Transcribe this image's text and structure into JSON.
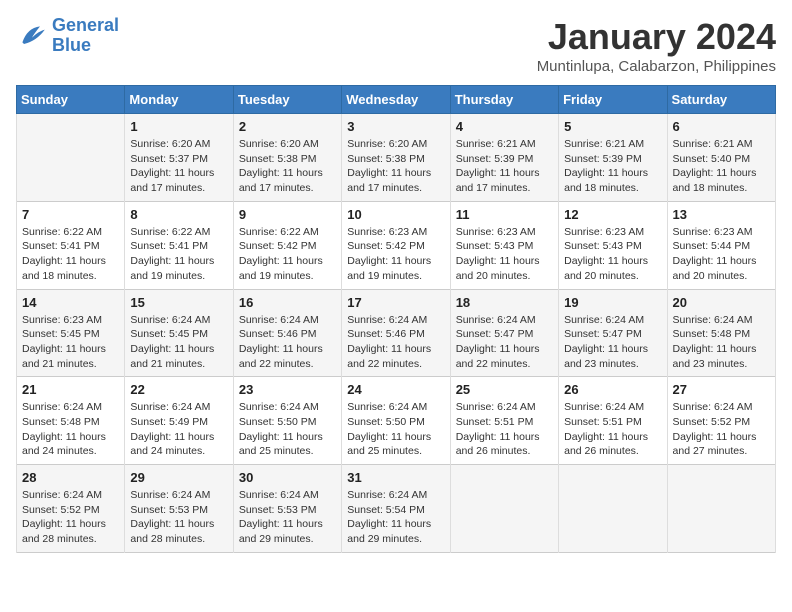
{
  "logo": {
    "line1": "General",
    "line2": "Blue"
  },
  "title": "January 2024",
  "subtitle": "Muntinlupa, Calabarzon, Philippines",
  "headers": [
    "Sunday",
    "Monday",
    "Tuesday",
    "Wednesday",
    "Thursday",
    "Friday",
    "Saturday"
  ],
  "weeks": [
    [
      {
        "num": "",
        "sunrise": "",
        "sunset": "",
        "daylight": ""
      },
      {
        "num": "1",
        "sunrise": "Sunrise: 6:20 AM",
        "sunset": "Sunset: 5:37 PM",
        "daylight": "Daylight: 11 hours and 17 minutes."
      },
      {
        "num": "2",
        "sunrise": "Sunrise: 6:20 AM",
        "sunset": "Sunset: 5:38 PM",
        "daylight": "Daylight: 11 hours and 17 minutes."
      },
      {
        "num": "3",
        "sunrise": "Sunrise: 6:20 AM",
        "sunset": "Sunset: 5:38 PM",
        "daylight": "Daylight: 11 hours and 17 minutes."
      },
      {
        "num": "4",
        "sunrise": "Sunrise: 6:21 AM",
        "sunset": "Sunset: 5:39 PM",
        "daylight": "Daylight: 11 hours and 17 minutes."
      },
      {
        "num": "5",
        "sunrise": "Sunrise: 6:21 AM",
        "sunset": "Sunset: 5:39 PM",
        "daylight": "Daylight: 11 hours and 18 minutes."
      },
      {
        "num": "6",
        "sunrise": "Sunrise: 6:21 AM",
        "sunset": "Sunset: 5:40 PM",
        "daylight": "Daylight: 11 hours and 18 minutes."
      }
    ],
    [
      {
        "num": "7",
        "sunrise": "Sunrise: 6:22 AM",
        "sunset": "Sunset: 5:41 PM",
        "daylight": "Daylight: 11 hours and 18 minutes."
      },
      {
        "num": "8",
        "sunrise": "Sunrise: 6:22 AM",
        "sunset": "Sunset: 5:41 PM",
        "daylight": "Daylight: 11 hours and 19 minutes."
      },
      {
        "num": "9",
        "sunrise": "Sunrise: 6:22 AM",
        "sunset": "Sunset: 5:42 PM",
        "daylight": "Daylight: 11 hours and 19 minutes."
      },
      {
        "num": "10",
        "sunrise": "Sunrise: 6:23 AM",
        "sunset": "Sunset: 5:42 PM",
        "daylight": "Daylight: 11 hours and 19 minutes."
      },
      {
        "num": "11",
        "sunrise": "Sunrise: 6:23 AM",
        "sunset": "Sunset: 5:43 PM",
        "daylight": "Daylight: 11 hours and 20 minutes."
      },
      {
        "num": "12",
        "sunrise": "Sunrise: 6:23 AM",
        "sunset": "Sunset: 5:43 PM",
        "daylight": "Daylight: 11 hours and 20 minutes."
      },
      {
        "num": "13",
        "sunrise": "Sunrise: 6:23 AM",
        "sunset": "Sunset: 5:44 PM",
        "daylight": "Daylight: 11 hours and 20 minutes."
      }
    ],
    [
      {
        "num": "14",
        "sunrise": "Sunrise: 6:23 AM",
        "sunset": "Sunset: 5:45 PM",
        "daylight": "Daylight: 11 hours and 21 minutes."
      },
      {
        "num": "15",
        "sunrise": "Sunrise: 6:24 AM",
        "sunset": "Sunset: 5:45 PM",
        "daylight": "Daylight: 11 hours and 21 minutes."
      },
      {
        "num": "16",
        "sunrise": "Sunrise: 6:24 AM",
        "sunset": "Sunset: 5:46 PM",
        "daylight": "Daylight: 11 hours and 22 minutes."
      },
      {
        "num": "17",
        "sunrise": "Sunrise: 6:24 AM",
        "sunset": "Sunset: 5:46 PM",
        "daylight": "Daylight: 11 hours and 22 minutes."
      },
      {
        "num": "18",
        "sunrise": "Sunrise: 6:24 AM",
        "sunset": "Sunset: 5:47 PM",
        "daylight": "Daylight: 11 hours and 22 minutes."
      },
      {
        "num": "19",
        "sunrise": "Sunrise: 6:24 AM",
        "sunset": "Sunset: 5:47 PM",
        "daylight": "Daylight: 11 hours and 23 minutes."
      },
      {
        "num": "20",
        "sunrise": "Sunrise: 6:24 AM",
        "sunset": "Sunset: 5:48 PM",
        "daylight": "Daylight: 11 hours and 23 minutes."
      }
    ],
    [
      {
        "num": "21",
        "sunrise": "Sunrise: 6:24 AM",
        "sunset": "Sunset: 5:48 PM",
        "daylight": "Daylight: 11 hours and 24 minutes."
      },
      {
        "num": "22",
        "sunrise": "Sunrise: 6:24 AM",
        "sunset": "Sunset: 5:49 PM",
        "daylight": "Daylight: 11 hours and 24 minutes."
      },
      {
        "num": "23",
        "sunrise": "Sunrise: 6:24 AM",
        "sunset": "Sunset: 5:50 PM",
        "daylight": "Daylight: 11 hours and 25 minutes."
      },
      {
        "num": "24",
        "sunrise": "Sunrise: 6:24 AM",
        "sunset": "Sunset: 5:50 PM",
        "daylight": "Daylight: 11 hours and 25 minutes."
      },
      {
        "num": "25",
        "sunrise": "Sunrise: 6:24 AM",
        "sunset": "Sunset: 5:51 PM",
        "daylight": "Daylight: 11 hours and 26 minutes."
      },
      {
        "num": "26",
        "sunrise": "Sunrise: 6:24 AM",
        "sunset": "Sunset: 5:51 PM",
        "daylight": "Daylight: 11 hours and 26 minutes."
      },
      {
        "num": "27",
        "sunrise": "Sunrise: 6:24 AM",
        "sunset": "Sunset: 5:52 PM",
        "daylight": "Daylight: 11 hours and 27 minutes."
      }
    ],
    [
      {
        "num": "28",
        "sunrise": "Sunrise: 6:24 AM",
        "sunset": "Sunset: 5:52 PM",
        "daylight": "Daylight: 11 hours and 28 minutes."
      },
      {
        "num": "29",
        "sunrise": "Sunrise: 6:24 AM",
        "sunset": "Sunset: 5:53 PM",
        "daylight": "Daylight: 11 hours and 28 minutes."
      },
      {
        "num": "30",
        "sunrise": "Sunrise: 6:24 AM",
        "sunset": "Sunset: 5:53 PM",
        "daylight": "Daylight: 11 hours and 29 minutes."
      },
      {
        "num": "31",
        "sunrise": "Sunrise: 6:24 AM",
        "sunset": "Sunset: 5:54 PM",
        "daylight": "Daylight: 11 hours and 29 minutes."
      },
      {
        "num": "",
        "sunrise": "",
        "sunset": "",
        "daylight": ""
      },
      {
        "num": "",
        "sunrise": "",
        "sunset": "",
        "daylight": ""
      },
      {
        "num": "",
        "sunrise": "",
        "sunset": "",
        "daylight": ""
      }
    ]
  ]
}
